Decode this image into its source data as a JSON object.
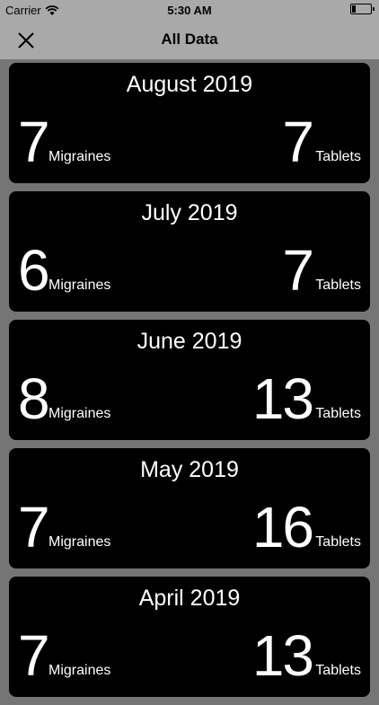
{
  "status_bar": {
    "carrier": "Carrier",
    "time": "5:30 AM"
  },
  "nav": {
    "title": "All Data",
    "close_icon": "close-icon"
  },
  "months": [
    {
      "title": "August 2019",
      "migraines": "7",
      "migraines_label": "Migraines",
      "tablets": "7",
      "tablets_label": "Tablets"
    },
    {
      "title": "July 2019",
      "migraines": "6",
      "migraines_label": "Migraines",
      "tablets": "7",
      "tablets_label": "Tablets"
    },
    {
      "title": "June 2019",
      "migraines": "8",
      "migraines_label": "Migraines",
      "tablets": "13",
      "tablets_label": "Tablets"
    },
    {
      "title": "May 2019",
      "migraines": "7",
      "migraines_label": "Migraines",
      "tablets": "16",
      "tablets_label": "Tablets"
    },
    {
      "title": "April 2019",
      "migraines": "7",
      "migraines_label": "Migraines",
      "tablets": "13",
      "tablets_label": "Tablets"
    }
  ]
}
